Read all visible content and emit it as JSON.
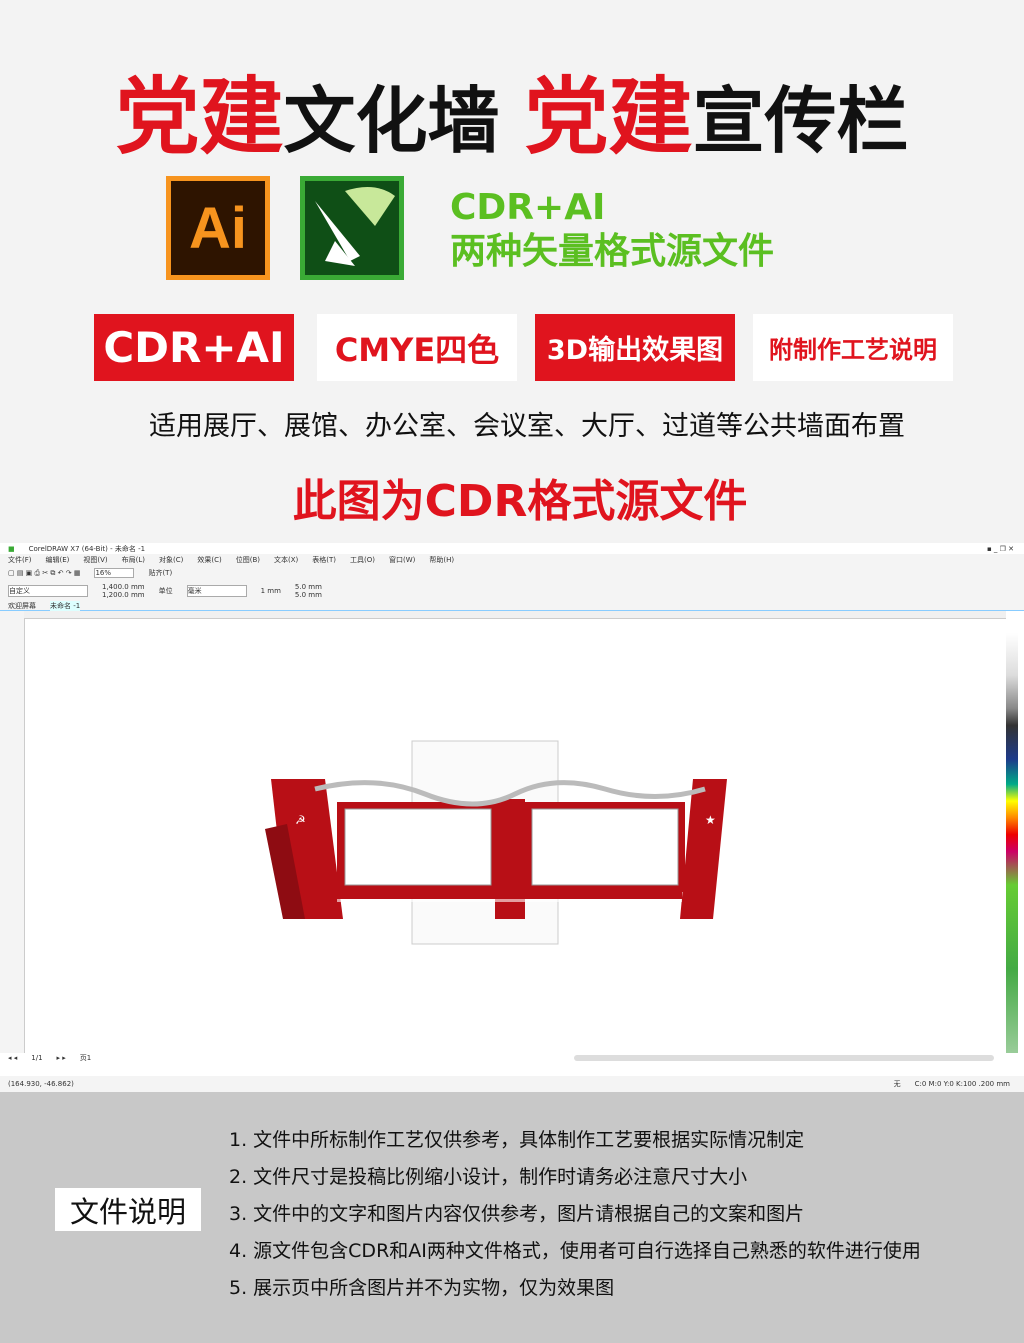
{
  "title": {
    "p1": "党建",
    "p2": "文化墙 ",
    "p3": "党建",
    "p4": "宣传栏"
  },
  "logos": {
    "ai": "Ai",
    "cdr": "corel-draw-logo"
  },
  "formats": {
    "line1": "CDR+AI",
    "line2": "两种矢量格式源文件"
  },
  "badges": [
    "CDR+AI",
    "CMYE四色",
    "3D输出效果图",
    "附制作工艺说明"
  ],
  "usage": "适用展厅、展馆、办公室、会议室、大厅、过道等公共墙面布置",
  "subtitle": "此图为CDR格式源文件",
  "app": {
    "window_title": "CorelDRAW X7 (64-Bit) - 未命名 -1",
    "menu": [
      "文件(F)",
      "编辑(E)",
      "视图(V)",
      "布局(L)",
      "对象(C)",
      "效果(C)",
      "位图(B)",
      "文本(X)",
      "表格(T)",
      "工具(O)",
      "窗口(W)",
      "帮助(H)"
    ],
    "zoom": "16%",
    "snap": "贴齐(T)",
    "preset": "自定义",
    "width": "1,400.0 mm",
    "height": "1,200.0 mm",
    "unit_label": "单位",
    "unit": "毫米",
    "nudge": "1 mm",
    "dup_x": "5.0 mm",
    "dup_y": "5.0 mm",
    "tabs": [
      "欢迎屏幕",
      "未命名 -1"
    ],
    "page": "1/1",
    "page_tab": "页1",
    "coords": "(164.930, -46.862)",
    "fill": "无",
    "outline": "C:0 M:0 Y:0 K:100  .200 mm",
    "colors": {
      "red": "#b80f16"
    }
  },
  "notes_title": "文件说明",
  "notes": [
    "1. 文件中所标制作工艺仅供参考，具体制作工艺要根据实际情况制定",
    "2. 文件尺寸是投稿比例缩小设计，制作时请务必注意尺寸大小",
    "3. 文件中的文字和图片内容仅供参考，图片请根据自己的文案和图片",
    "4. 源文件包含CDR和AI两种文件格式，使用者可自行选择自己熟悉的软件进行使用",
    "5. 展示页中所含图片并不为实物，仅为效果图"
  ]
}
